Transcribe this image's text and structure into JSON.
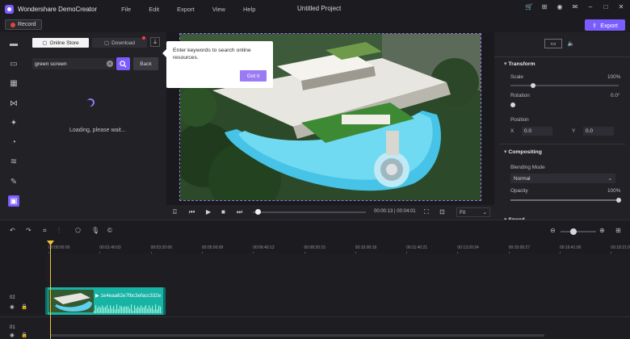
{
  "app": {
    "name": "Wondershare DemoCreator",
    "project_title": "Untitled Project",
    "menu": [
      "File",
      "Edit",
      "Export",
      "View",
      "Help"
    ],
    "window_icons": [
      "cart-icon",
      "gift-icon",
      "avatar-icon",
      "notification-icon",
      "minimize-icon",
      "maximize-icon",
      "close-icon"
    ]
  },
  "toolbar": {
    "record_label": "Record",
    "export_label": "Export"
  },
  "sidebar": {
    "tools": [
      "media-icon",
      "captions-icon",
      "templates-icon",
      "transitions-icon",
      "effects-icon",
      "stickers-icon",
      "audio-icon",
      "pin-icon",
      "store-icon"
    ],
    "active_tool": "store-icon"
  },
  "resources": {
    "tab_online": "Online Store",
    "tab_download": "Download",
    "search_value": "green screen",
    "back_label": "Back",
    "loading_text": "Loading, please wait..."
  },
  "tooltip": {
    "text": "Enter keywords to search online resources.",
    "button": "Got it"
  },
  "player": {
    "time_current": "00:00:13",
    "time_total": "00:04:01",
    "fit_label": "Fit",
    "progress": 0.02
  },
  "properties": {
    "transform_title": "Transform",
    "scale_label": "Scale",
    "scale_value": "100%",
    "rotation_label": "Rotation",
    "rotation_value": "0.0°",
    "position_label": "Position",
    "x_label": "X",
    "x_value": "0.0",
    "y_label": "Y",
    "y_value": "0.0",
    "compositing_title": "Compositing",
    "blending_label": "Blending Mode",
    "blending_value": "Normal",
    "opacity_label": "Opacity",
    "opacity_value": "100%",
    "speed_title": "Speed"
  },
  "timeline": {
    "ruler": [
      "00:00:00:00",
      "00:01:40:03",
      "00:03:20:06",
      "00:05:00:09",
      "00:06:40:12",
      "00:08:20:15",
      "00:10:00:18",
      "00:11:40:21",
      "00:13:20:24",
      "00:15:00:27",
      "00:16:41:00",
      "00:18:21:03"
    ],
    "tracks": [
      {
        "num": "02"
      },
      {
        "num": "01"
      }
    ],
    "clip_name": "1e4eaa62e7fbc3efacc332e"
  },
  "colors": {
    "accent": "#7b5cff",
    "clip": "#17b3a5",
    "playhead": "#f2c23a"
  }
}
